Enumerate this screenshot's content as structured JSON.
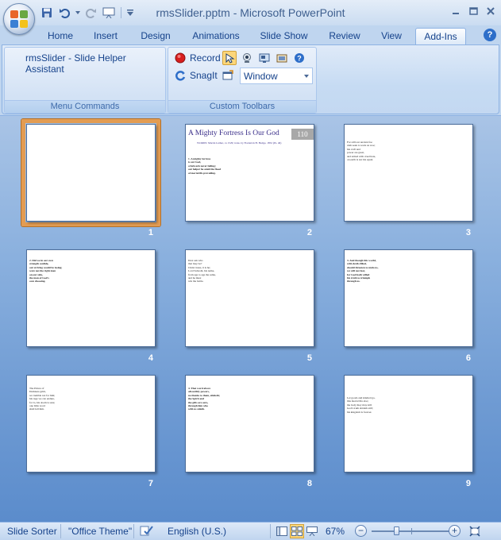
{
  "window": {
    "title": "rmsSlider.pptm - Microsoft PowerPoint",
    "controls": [
      "minimize",
      "maximize",
      "close"
    ]
  },
  "tabs": [
    {
      "label": "Home",
      "active": false
    },
    {
      "label": "Insert",
      "active": false
    },
    {
      "label": "Design",
      "active": false
    },
    {
      "label": "Animations",
      "active": false
    },
    {
      "label": "Slide Show",
      "active": false
    },
    {
      "label": "Review",
      "active": false
    },
    {
      "label": "View",
      "active": false
    },
    {
      "label": "Add-Ins",
      "active": true
    }
  ],
  "ribbon": {
    "menu_commands": {
      "item_label": "rmsSlider - Slide Helper Assistant",
      "group_label": "Menu Commands"
    },
    "custom_toolbars": {
      "record_label": "Record",
      "snagit_label": "SnagIt",
      "window_value": "Window",
      "group_label": "Custom Toolbars"
    }
  },
  "slides": [
    {
      "number": "1",
      "selected": true,
      "text": ""
    },
    {
      "number": "2",
      "selected": false,
      "title": "A Mighty Fortress Is Our God",
      "badge": "110",
      "subtitle": "WORDS: Martin Luther, ca 1529; trans. by Frederick H. Hedge, 1852 (Ps. 46)",
      "text": "1. A mighty fortress\nis our God,\na bulwark never failing;\nour helper he amid the flood\nof mortal ills prevailing."
    },
    {
      "number": "3",
      "selected": false,
      "text": "For still our ancient foe\ndoth seek to work us woe;\nhis craft and\npower are great,\nand armed with cruel hate,\non earth is not his equal."
    },
    {
      "number": "4",
      "selected": false,
      "text": "2. Did we in our own\nstrength confide,\nour striving would be losing;\nwere not the right man\non our side,\nthe man of God's\nown choosing."
    },
    {
      "number": "5",
      "selected": false,
      "text": "Dost ask who\nthat may be?\nChrist Jesus, it is he;\nLord Sabaoth, his name,\nfrom age to age the same,\nand he must\nwin the battle."
    },
    {
      "number": "6",
      "selected": false,
      "text": "3. And though this world,\nwith devils filled,\nshould threaten to undo us,\nwe will not fear,\nfor God hath willed\nhis truth to triumph\nthrough us."
    },
    {
      "number": "7",
      "selected": false,
      "text": "The Prince of\nDarkness grim,\nwe tremble not for him;\nhis rage we can endure,\nfor lo, his doom is sure;\none little word\nshall fell him."
    },
    {
      "number": "8",
      "selected": false,
      "text": "4. That word above\nall earthly powers,\nno thanks to them, abideth;\nthe Spirit and\nthe gifts are ours,\nthrough him who\nwith us sideth."
    },
    {
      "number": "9",
      "selected": false,
      "text": "Let goods and kindred go,\nthis mortal life also;\nthe body they may kill:\nGod's truth abideth still;\nhis kingdom is forever."
    }
  ],
  "statusbar": {
    "view_name": "Slide Sorter",
    "theme": "\"Office Theme\"",
    "language": "English (U.S.)",
    "zoom": "67%",
    "zoom_value_percent": 67
  }
}
